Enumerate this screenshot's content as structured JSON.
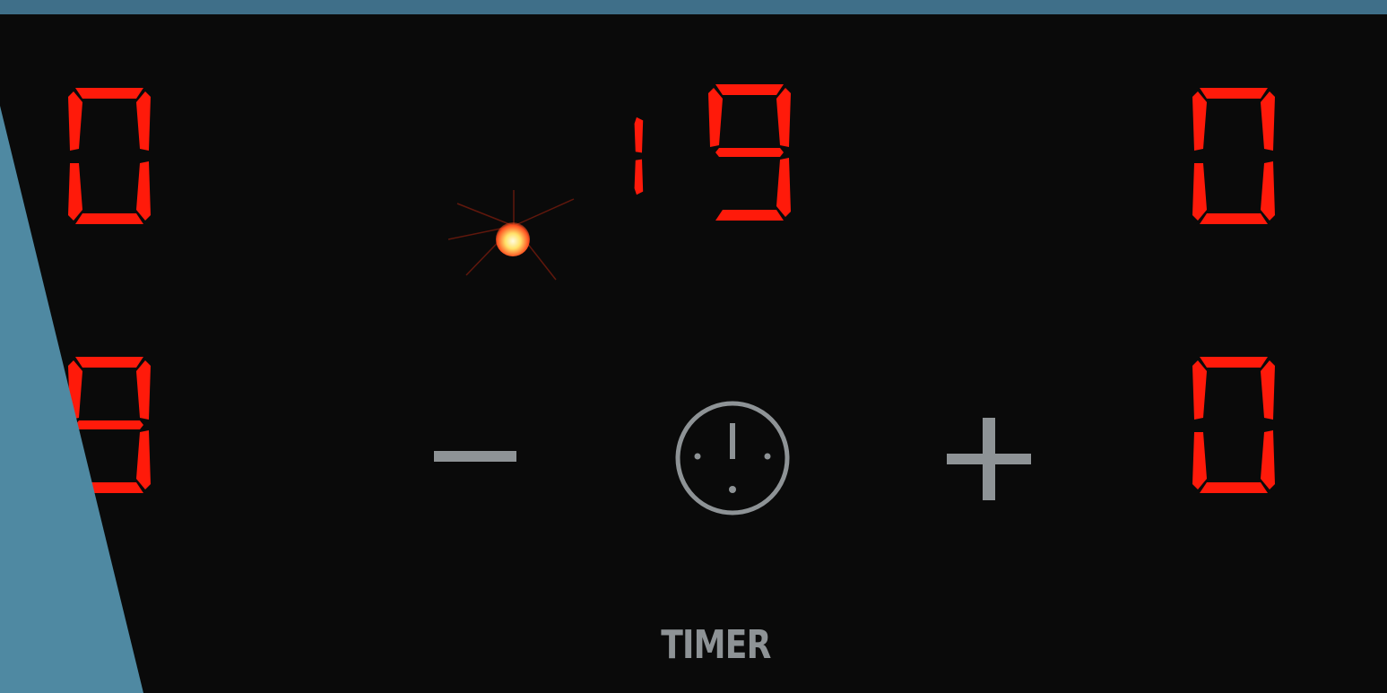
{
  "displays": {
    "top_left": "0",
    "top_center": "19",
    "top_right": "0",
    "bottom_left": "9",
    "bottom_right": "0"
  },
  "controls": {
    "minus_label": "−",
    "plus_label": "+",
    "timer_label": "TIMER"
  },
  "indicator": {
    "state": "on",
    "color": "#ffd84a"
  },
  "colors": {
    "segment_on": "#ff1a0a",
    "panel_background": "#0a0a0a",
    "button_gray": "#8e9396",
    "frame_blue": "#4f89a2"
  },
  "icons": [
    "minus-icon",
    "clock-icon",
    "plus-icon"
  ]
}
